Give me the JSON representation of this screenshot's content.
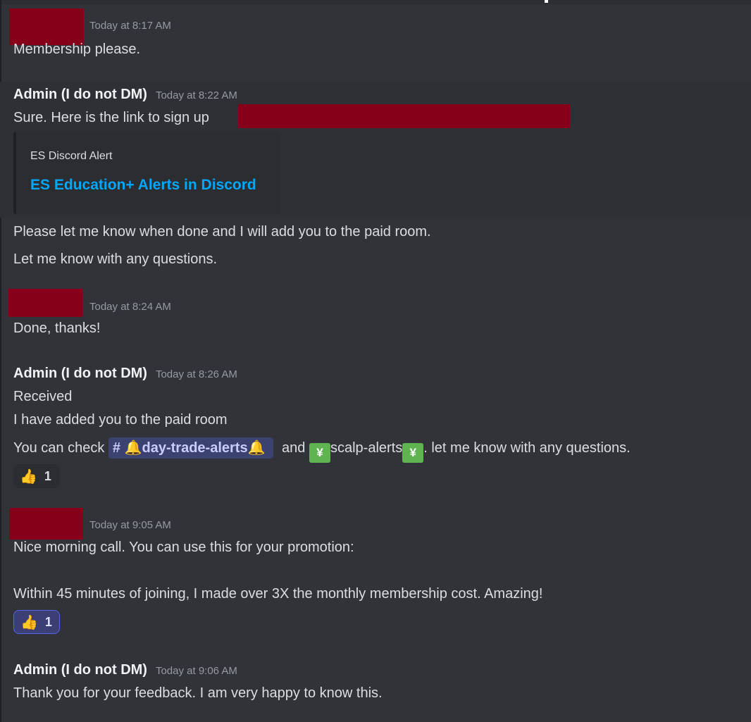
{
  "messages": [
    {
      "author": "",
      "time": "Today at 8:17 AM",
      "lines": [
        "Membership please."
      ]
    },
    {
      "author": "Admin (I do not DM)",
      "time": "Today at 8:22 AM",
      "lines": [
        "Sure. Here is the link to sign up",
        "Please let me know when done and I will add you to the paid room.",
        "Let me know with any questions."
      ],
      "embed": {
        "provider": "ES Discord Alert",
        "title": "ES Education+ Alerts in Discord"
      }
    },
    {
      "author": "",
      "time": "Today at 8:24 AM",
      "lines": [
        "Done, thanks!"
      ]
    },
    {
      "author": "Admin (I do not DM)",
      "time": "Today at 8:26 AM",
      "lines": [
        "Received",
        "I have added you to the paid room"
      ],
      "channel_line": {
        "prefix": "You can check",
        "channel1": "day-trade-alerts",
        "middle": "and",
        "channel2": "scalp-alerts",
        "suffix": ". let me know with any questions."
      },
      "reaction": {
        "emoji": "thumbs-up",
        "count": "1"
      }
    },
    {
      "author": "",
      "time": "Today at 9:05 AM",
      "lines": [
        "Nice morning call. You can use this for your promotion:",
        "Within 45 minutes of joining, I made over 3X the monthly membership cost. Amazing!"
      ],
      "reaction": {
        "emoji": "thumbs-up",
        "count": "1"
      }
    },
    {
      "author": "Admin (I do not DM)",
      "time": "Today at 9:06 AM",
      "lines": [
        "Thank you for your feedback. I am very happy to know this."
      ]
    }
  ],
  "colors": {
    "background": "#313338",
    "redaction": "#86001a",
    "link": "#00a8fc",
    "mention_bg": "#3c4270"
  },
  "icons": {
    "hash": "hash-icon",
    "bell": "bell-icon",
    "yen_chart": "yen-chart-icon",
    "thumbs_up": "thumbs-up-icon"
  }
}
